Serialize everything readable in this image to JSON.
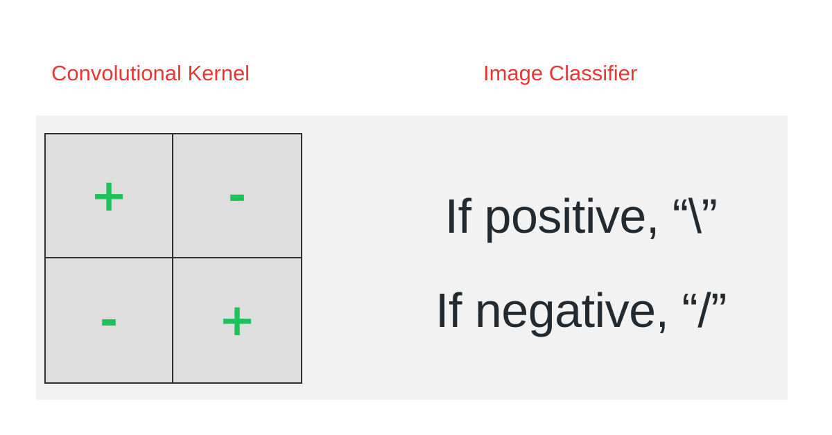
{
  "colors": {
    "heading": "#e53935",
    "sign": "#1ec25a",
    "text": "#232a30",
    "grid_border": "#2f2f2f",
    "cell_fill": "#dedede",
    "panel_fill": "#f2f2f2"
  },
  "headings": {
    "left": "Convolutional Kernel",
    "right": "Image Classifier"
  },
  "kernel": {
    "cells": [
      {
        "sign": "+"
      },
      {
        "sign": "-"
      },
      {
        "sign": "-"
      },
      {
        "sign": "+"
      }
    ]
  },
  "classifier": {
    "rules": [
      "If positive, “\\”",
      "If negative, “/”"
    ]
  }
}
